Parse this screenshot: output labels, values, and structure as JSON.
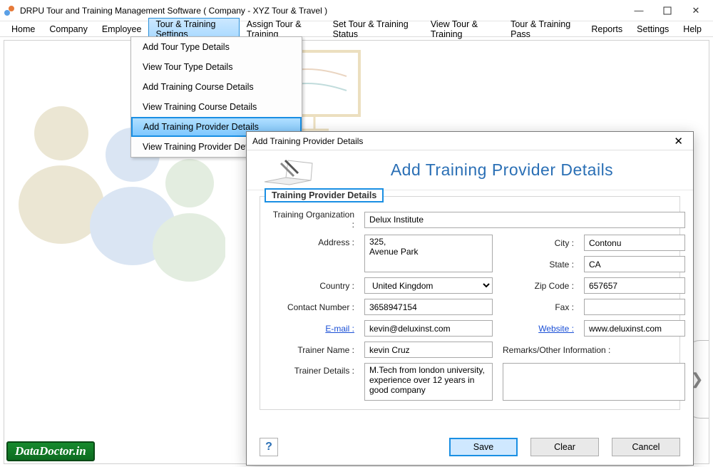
{
  "window": {
    "title": "DRPU Tour and Training Management Software  ( Company - XYZ Tour & Travel )"
  },
  "menu": {
    "items": [
      "Home",
      "Company",
      "Employee",
      "Tour & Training Settings",
      "Assign Tour & Training",
      "Set Tour & Training Status",
      "View Tour & Training",
      "Tour & Training Pass",
      "Reports",
      "Settings",
      "Help"
    ],
    "open_index": 3,
    "dropdown": {
      "items": [
        "Add Tour Type Details",
        "View Tour Type Details",
        "Add Training Course Details",
        "View Training Course Details",
        "Add Training Provider Details",
        "View Training Provider Details"
      ],
      "sel_index": 4
    }
  },
  "brand": "DataDoctor.in",
  "dialog": {
    "title": "Add Training Provider Details",
    "heading": "Add Training Provider Details",
    "legend": "Training Provider Details",
    "labels": {
      "org": "Training Organization :",
      "address": "Address :",
      "city": "City :",
      "state": "State :",
      "country": "Country :",
      "zip": "Zip Code :",
      "contact": "Contact Number :",
      "fax": "Fax :",
      "email": "E-mail :",
      "website": "Website :",
      "trainer": "Trainer Name :",
      "remarks": "Remarks/Other Information :",
      "details": "Trainer Details :"
    },
    "values": {
      "org": "Delux Institute",
      "address": "325,\nAvenue Park",
      "city": "Contonu",
      "state": "CA",
      "country": "United Kingdom",
      "zip": "657657",
      "contact": "3658947154",
      "fax": "",
      "email": "kevin@deluxinst.com",
      "website": "www.deluxinst.com",
      "trainer": "kevin Cruz",
      "remarks": "",
      "details": "M.Tech from london university, experience over 12 years in good company"
    },
    "buttons": {
      "save": "Save",
      "clear": "Clear",
      "cancel": "Cancel",
      "help": "?"
    }
  }
}
